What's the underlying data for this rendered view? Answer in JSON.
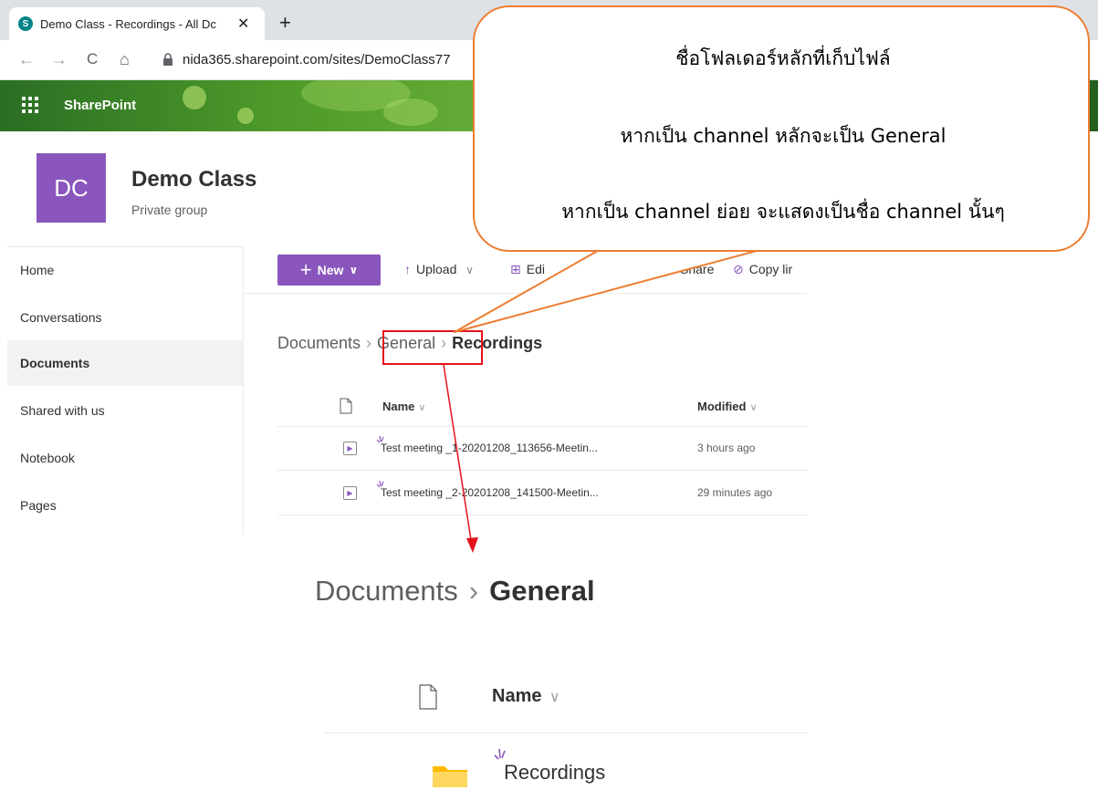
{
  "browser": {
    "tab_title": "Demo Class - Recordings - All Dc",
    "tab_favicon": "S",
    "tab_close": "✕",
    "new_tab": "+",
    "url": "nida365.sharepoint.com/sites/DemoClass77"
  },
  "suite": {
    "app_name": "SharePoint",
    "waffle_icon": "waffle-icon"
  },
  "site": {
    "logo_initials": "DC",
    "name": "Demo Class",
    "subtitle": "Private group"
  },
  "left_nav": {
    "items": [
      {
        "label": "Home"
      },
      {
        "label": "Conversations"
      },
      {
        "label": "Documents",
        "selected": true
      },
      {
        "label": "Shared with us"
      },
      {
        "label": "Notebook"
      },
      {
        "label": "Pages"
      }
    ]
  },
  "command_bar": {
    "new_label": "New",
    "upload_label": "Upload",
    "edit_label": "Edi",
    "share_label": "Share",
    "copy_link_label": "Copy lir"
  },
  "breadcrumb": {
    "root": "Documents",
    "middle": "General",
    "current": "Recordings"
  },
  "list": {
    "col_name": "Name",
    "col_modified": "Modified",
    "rows": [
      {
        "name": "Test meeting _1-20201208_113656-Meetin...",
        "modified": "3 hours ago"
      },
      {
        "name": "Test meeting _2-20201208_141500-Meetin...",
        "modified": "29 minutes ago"
      }
    ]
  },
  "zoom": {
    "crumb_root": "Documents",
    "crumb_current": "General",
    "col_name": "Name",
    "folder_name": "Recordings"
  },
  "callout": {
    "line1": "ชื่อโฟลเดอร์หลักที่เก็บไฟล์",
    "line2": "หากเป็น channel หลักจะเป็น General",
    "line3": "หากเป็น channel ย่อย จะแสดงเป็นชื่อ channel นั้นๆ"
  },
  "colors": {
    "accent_purple": "#8a56bd",
    "highlight_red": "#e3131b",
    "callout_orange": "#ed7d31"
  }
}
